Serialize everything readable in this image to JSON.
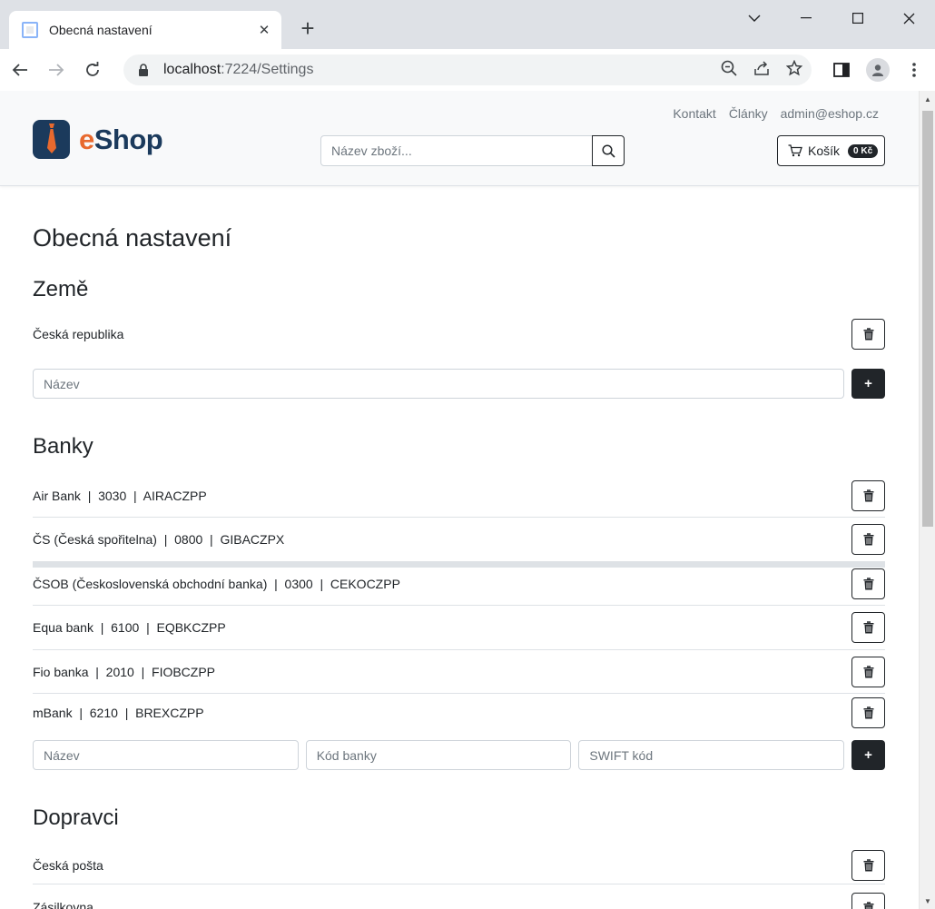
{
  "browser": {
    "tab_title": "Obecná nastavení",
    "tab_close": "✕",
    "new_tab": "+",
    "url_host": "localhost",
    "url_path": ":7224/Settings"
  },
  "header": {
    "logo_e": "e",
    "logo_shop": "Shop",
    "links": [
      "Kontakt",
      "Články",
      "admin@eshop.cz"
    ],
    "search_placeholder": "Název zboží...",
    "cart_label": "Košík",
    "cart_total": "0 Kč"
  },
  "page_title": "Obecná nastavení",
  "countries": {
    "title": "Země",
    "items": [
      "Česká republika"
    ],
    "name_placeholder": "Název"
  },
  "banks": {
    "title": "Banky",
    "items": [
      "Air Bank  |  3030  |  AIRACZPP",
      "ČS (Česká spořitelna)  |  0800  |  GIBACZPX",
      "ČSOB (Československá obchodní banka)  |  0300  |  CEKOCZPP",
      "Equa bank  |  6100  |  EQBKCZPP",
      "Fio banka  |  2010  |  FIOBCZPP",
      "mBank  |  6210  |  BREXCZPP"
    ],
    "name_placeholder": "Název",
    "code_placeholder": "Kód banky",
    "swift_placeholder": "SWIFT kód"
  },
  "carriers": {
    "title": "Dopravci",
    "items": [
      "Česká pošta",
      "Zásilkovna"
    ]
  },
  "add_label": "+",
  "colors": {
    "accent": "#e8692e",
    "brand": "#1b3a5c",
    "dark": "#212529"
  }
}
